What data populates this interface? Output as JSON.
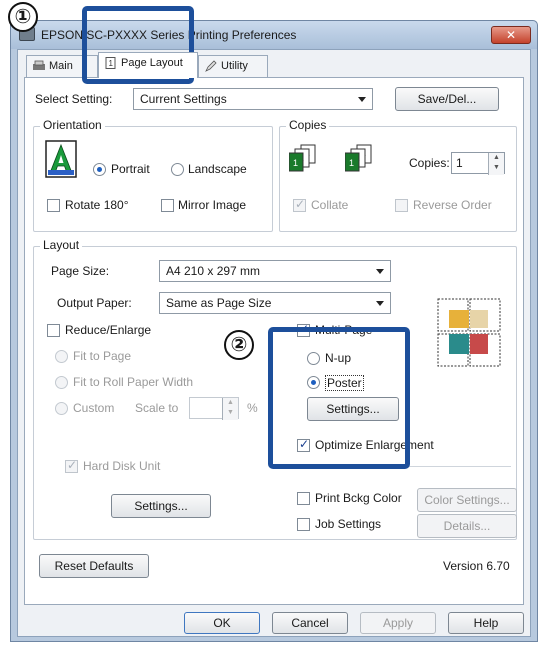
{
  "window": {
    "title": "EPSON SC-PXXXX Series Printing Preferences",
    "close_label": "✕"
  },
  "tabs": [
    {
      "label": "Main",
      "icon": "printer-icon"
    },
    {
      "label": "Page Layout",
      "icon": "page-icon"
    },
    {
      "label": "Utility",
      "icon": "pencil-icon"
    }
  ],
  "select_setting": {
    "label": "Select Setting:",
    "value": "Current Settings",
    "save_label": "Save/Del..."
  },
  "orientation": {
    "title": "Orientation",
    "portrait": "Portrait",
    "landscape": "Landscape",
    "rotate": "Rotate 180°",
    "mirror": "Mirror Image"
  },
  "copies": {
    "title": "Copies",
    "copies_label": "Copies:",
    "copies_value": "1",
    "collate": "Collate",
    "reverse": "Reverse Order"
  },
  "layout": {
    "title": "Layout",
    "page_size_label": "Page Size:",
    "page_size_value": "A4 210 x 297 mm",
    "output_label": "Output Paper:",
    "output_value": "Same as Page Size",
    "reduce": "Reduce/Enlarge",
    "fit_page": "Fit to Page",
    "fit_roll": "Fit to Roll Paper Width",
    "custom": "Custom",
    "scale_to": "Scale to",
    "percent": "%",
    "multi_page": "Multi-Page",
    "n_up": "N-up",
    "poster": "Poster",
    "settings": "Settings...",
    "optimize": "Optimize Enlargement"
  },
  "lower": {
    "hard_disk": "Hard Disk Unit",
    "settings": "Settings...",
    "print_bckg": "Print Bckg Color",
    "color_settings": "Color Settings...",
    "job_settings": "Job Settings",
    "details": "Details..."
  },
  "footer": {
    "reset": "Reset Defaults",
    "version": "Version 6.70"
  },
  "dialog_buttons": {
    "ok": "OK",
    "cancel": "Cancel",
    "apply": "Apply",
    "help": "Help"
  },
  "callouts": {
    "one": "①",
    "two": "②"
  },
  "colors": {
    "highlight": "#1d4f9b",
    "title_bar": "#b7c9de"
  }
}
